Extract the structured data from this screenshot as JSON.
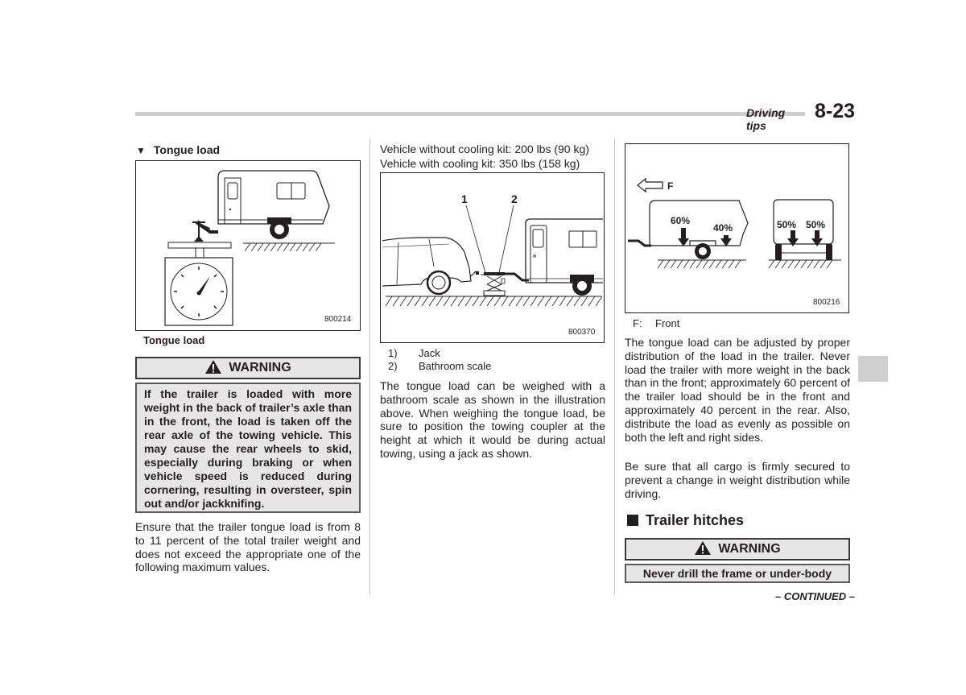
{
  "header": {
    "section": "Driving tips",
    "page": "8-23"
  },
  "col1": {
    "subheading": "Tongue load",
    "subheading_marker": "▼",
    "figure_code": "800214",
    "figure_caption": "Tongue load",
    "warning": {
      "title": "WARNING",
      "lines": [
        "If the trailer is loaded with more weight in the back of trailer’s axle than in the front, the load is taken off the rear axle of the towing vehicle. This may cause the rear wheels to skid, especially during braking or when vehicle speed is reduced during cornering, resulting in oversteer, spin out and/or jackknifing."
      ]
    },
    "paragraph": "Ensure that the trailer tongue load is from 8 to 11 percent of the total trailer weight and does not exceed the appropriate one of the following maximum values."
  },
  "col2": {
    "limits": [
      "Vehicle without cooling kit: 200 lbs (90 kg)",
      "Vehicle with cooling kit: 350 lbs (158 kg)"
    ],
    "figure_code": "800370",
    "callouts": [
      "1",
      "2"
    ],
    "legend": [
      {
        "num": "1)",
        "label": "Jack"
      },
      {
        "num": "2)",
        "label": "Bathroom scale"
      }
    ],
    "paragraph": "The tongue load can be weighed with a bathroom scale as shown in the illustration above. When weighing the tongue load, be sure to position the towing coupler at the height at which it would be during actual towing, using a jack as shown."
  },
  "col3": {
    "figure_code": "800216",
    "figure_labels": {
      "front_marker": "F",
      "front_pct": "60%",
      "rear_pct": "40%",
      "left_pct": "50%",
      "right_pct": "50%"
    },
    "legend": {
      "key": "F:",
      "label": "Front"
    },
    "paragraph1": "The tongue load can be adjusted by proper distribution of the load in the trailer. Never load the trailer with more weight in the back than in the front; approximately 60 percent of the trailer load should be in the front and approximately 40 percent in the rear. Also, distribute the load as evenly as possible on both the left and right sides.",
    "paragraph2": "Be sure that all cargo is firmly secured to prevent a change in weight distribution while driving.",
    "section_title": "Trailer hitches",
    "warning": {
      "title": "WARNING",
      "text": "Never drill the frame or under-body"
    },
    "continued": "– CONTINUED –"
  }
}
